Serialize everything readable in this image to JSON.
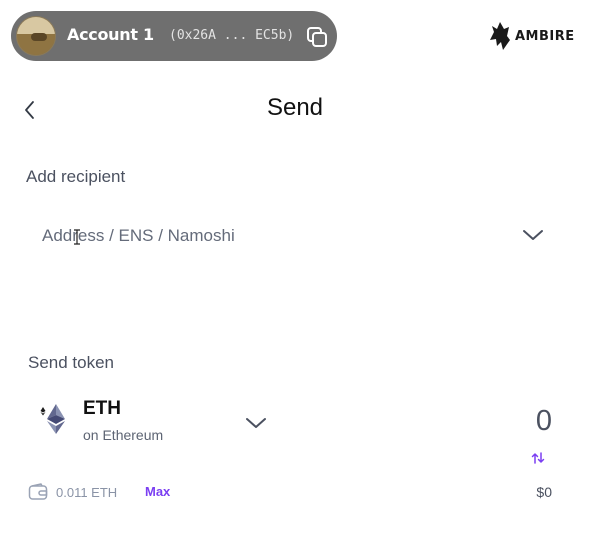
{
  "header": {
    "account_name": "Account 1",
    "account_address": "(0x26A ... EC5b)",
    "logo_text": "AMBIRE",
    "icons": {
      "copy": "copy-icon",
      "logo": "ambire-flame-icon"
    }
  },
  "page": {
    "title": "Send",
    "back_icon": "chevron-left-icon"
  },
  "recipient": {
    "label": "Add recipient",
    "placeholder": "Address / ENS / Namoshi",
    "value": ""
  },
  "send_token": {
    "label": "Send token",
    "token_symbol": "ETH",
    "token_network": "on Ethereum",
    "amount": "0",
    "balance": "0.011 ETH",
    "max_label": "Max",
    "usd_value": "$0"
  },
  "colors": {
    "accent": "#7b3ff2",
    "account_pill": "#6f6f6f",
    "muted_text": "#8a93a6"
  }
}
